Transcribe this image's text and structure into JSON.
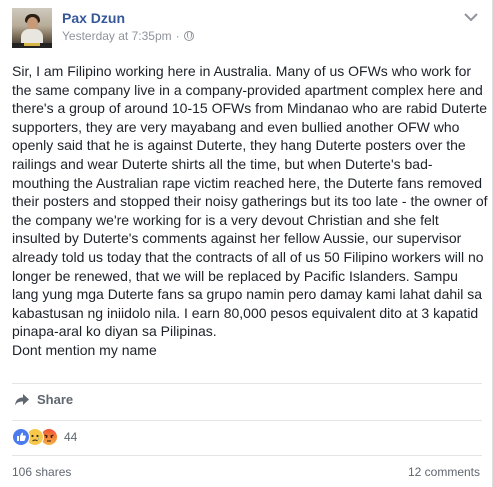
{
  "post": {
    "author": "Pax Dzun",
    "timestamp": "Yesterday at 7:35pm",
    "separator": "·",
    "privacy_icon": "globe-icon",
    "body": "Sir, I am Filipino working here in Australia. Many of us OFWs who work for the same company live in a company-provided apartment complex here and there's a group of around 10-15 OFWs from Mindanao who are rabid Duterte supporters, they are very mayabang and even bullied another OFW who openly said that he is against Duterte, they hang Duterte posters over the railings and wear Duterte shirts all the time, but when Duterte's bad-mouthing the Australian rape victim reached here, the Duterte fans removed their posters and stopped their noisy gatherings but its too late - the owner of the company we're working for is a very devout Christian and she felt insulted by Duterte's comments against her fellow Aussie, our supervisor already told us today that the contracts of all of us 50 Filipino workers will no longer be renewed, that we will be replaced by Pacific Islanders. Sampu lang yung mga Duterte fans sa grupo namin pero damay kami lahat dahil sa kabastusan ng iniidolo nila. I earn 80,000 pesos equivalent dito at 3 kapatid pinapa-aral ko diyan sa Pilipinas.\nDont mention my name"
  },
  "actions": {
    "share_label": "Share"
  },
  "reactions": {
    "types": [
      "like",
      "sad",
      "angry"
    ],
    "count": "44"
  },
  "stats": {
    "shares": "106 shares",
    "comments": "12 comments"
  },
  "colors": {
    "link": "#365899",
    "meta": "#90949c",
    "text": "#1d2129"
  }
}
